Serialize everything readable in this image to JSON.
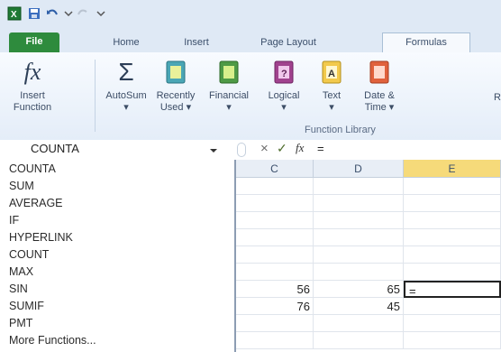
{
  "colors": {
    "file_tab": "#2e8b3d",
    "accent": "#f2c94c"
  },
  "tabs": [
    "File",
    "Home",
    "Insert",
    "Page Layout",
    "Formulas"
  ],
  "ribbon": {
    "buttons": [
      {
        "line1": "Insert",
        "line2": "Function",
        "icon": "insert-function-icon"
      },
      {
        "line1": "AutoSum",
        "line2": "▾",
        "icon": "autosum-icon"
      },
      {
        "line1": "Recently",
        "line2": "Used ▾",
        "icon": "recently-used-icon"
      },
      {
        "line1": "Financial",
        "line2": "▾",
        "icon": "financial-icon"
      },
      {
        "line1": "Logical",
        "line2": "▾",
        "icon": "logical-icon"
      },
      {
        "line1": "Text",
        "line2": "▾",
        "icon": "text-icon"
      },
      {
        "line1": "Date &",
        "line2": "Time ▾",
        "icon": "date-time-icon"
      },
      {
        "line1": "R",
        "line2": "",
        "icon": "more-icon"
      }
    ],
    "group_label": "Function Library"
  },
  "formula_bar": {
    "name_box": "COUNTA",
    "cancel": "×",
    "enter": "✓",
    "fx": "fx",
    "content": "="
  },
  "sheet": {
    "columns": [
      "C",
      "D",
      "E"
    ],
    "rows": [
      {
        "c": "",
        "d": "",
        "e": ""
      },
      {
        "c": "",
        "d": "",
        "e": ""
      },
      {
        "c": "",
        "d": "",
        "e": ""
      },
      {
        "c": "",
        "d": "",
        "e": ""
      },
      {
        "c": "",
        "d": "",
        "e": ""
      },
      {
        "c": "",
        "d": "",
        "e": ""
      },
      {
        "c": "56",
        "d": "65",
        "e": "="
      },
      {
        "c": "76",
        "d": "45",
        "e": ""
      },
      {
        "c": "",
        "d": "",
        "e": ""
      },
      {
        "c": "",
        "d": "",
        "e": ""
      }
    ]
  },
  "function_list": [
    "COUNTA",
    "SUM",
    "AVERAGE",
    "IF",
    "HYPERLINK",
    "COUNT",
    "MAX",
    "SIN",
    "SUMIF",
    "PMT",
    "More Functions..."
  ]
}
